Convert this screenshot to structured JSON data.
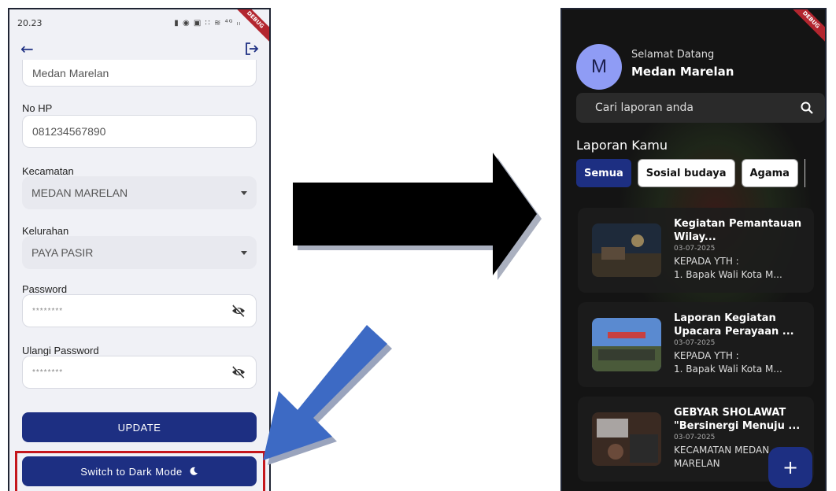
{
  "left_phone": {
    "status_time": "20.23",
    "status_icons": "▮ ◉ ▣ ∷ ≋ ⁴ᴳ ₗₗ",
    "debug_label": "DEBUG",
    "partial_field_value": "Medan Marelan",
    "phone_label": "No HP",
    "phone_value": "081234567890",
    "kecamatan_label": "Kecamatan",
    "kecamatan_value": "MEDAN MARELAN",
    "kelurahan_label": "Kelurahan",
    "kelurahan_value": "PAYA PASIR",
    "password_label": "Password",
    "password_value": "********",
    "repeat_password_label": "Ulangi Password",
    "repeat_password_value": "********",
    "update_label": "UPDATE",
    "dark_mode_label": "Switch to Dark Mode"
  },
  "right_phone": {
    "debug_label": "DEBUG",
    "avatar_letter": "M",
    "welcome_text": "Selamat Datang",
    "user_name": "Medan Marelan",
    "search_placeholder": "Cari laporan anda",
    "section_title": "Laporan Kamu",
    "chips": [
      "Semua",
      "Sosial budaya",
      "Agama"
    ],
    "reports": [
      {
        "title": "Kegiatan Pemantauan Wilay...",
        "date": "03-07-2025",
        "snippet": "KEPADA YTH :\n1. Bapak Wali Kota M..."
      },
      {
        "title": "Laporan Kegiatan Upacara Perayaan ...",
        "date": "03-07-2025",
        "snippet": "KEPADA YTH :\n1. Bapak Wali Kota M..."
      },
      {
        "title": "GEBYAR SHOLAWAT \"Bersinergi Menuju ...",
        "date": "03-07-2025",
        "snippet": "KECAMATAN MEDAN MARELAN"
      }
    ],
    "fab_label": "+"
  },
  "colors": {
    "primary": "#1d2f82",
    "highlight": "#c4161c",
    "arrow_blue": "#3d6ac4",
    "dark_bg": "#141414"
  }
}
